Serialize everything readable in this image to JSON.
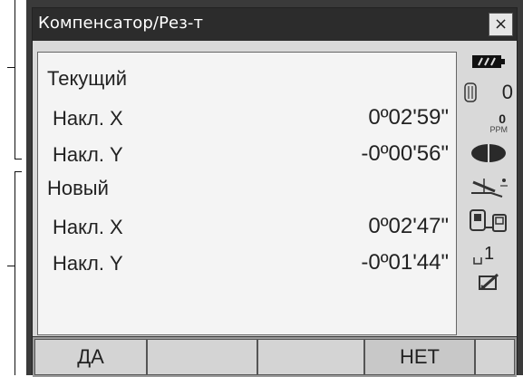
{
  "window": {
    "title": "Компенсатор/Рез-т",
    "close_glyph": "×"
  },
  "current": {
    "heading": "Текущий",
    "tilt_x_label": "Накл. X",
    "tilt_x_value": "0º02'59\"",
    "tilt_y_label": "Накл. Y",
    "tilt_y_value": "-0º00'56\""
  },
  "new": {
    "heading": "Новый",
    "tilt_x_label": "Накл. X",
    "tilt_x_value": "0º02'47\"",
    "tilt_y_label": "Накл. Y",
    "tilt_y_value": "-0º01'44\""
  },
  "status": {
    "prism_constant": "0",
    "ppm_value": "0",
    "ppm_unit": "PPM",
    "page_indicator": "1"
  },
  "softkeys": {
    "f1": "ДА",
    "f2": "",
    "f3": "",
    "f4": "НЕТ",
    "f5": ""
  }
}
